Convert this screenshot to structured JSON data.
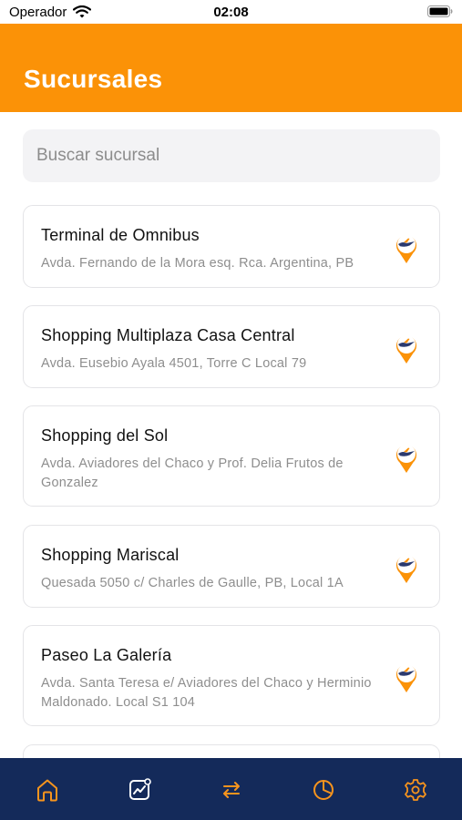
{
  "status_bar": {
    "carrier": "Operador",
    "time": "02:08"
  },
  "header": {
    "title": "Sucursales"
  },
  "search": {
    "placeholder": "Buscar sucursal"
  },
  "branches": [
    {
      "name": "Terminal de Omnibus",
      "address": "Avda. Fernando de la Mora esq. Rca. Argentina, PB"
    },
    {
      "name": "Shopping Multiplaza Casa Central",
      "address": "Avda. Eusebio Ayala 4501, Torre C Local 79"
    },
    {
      "name": "Shopping del Sol",
      "address": "Avda. Aviadores del Chaco y Prof. Delia Frutos de Gonzalez"
    },
    {
      "name": "Shopping Mariscal",
      "address": "Quesada 5050 c/ Charles de Gaulle, PB, Local 1A"
    },
    {
      "name": "Paseo La Galería",
      "address": "Avda. Santa Teresa e/ Aviadores del Chaco y Herminio Maldonado. Local S1 104"
    }
  ],
  "tab_bar": {
    "items": [
      "home-icon",
      "chart-icon",
      "transfer-icon",
      "pie-chart-icon",
      "settings-icon"
    ]
  },
  "colors": {
    "accent": "#fb9207",
    "tab_bar": "#142a5a",
    "pin_navy": "#2b3a6e"
  }
}
